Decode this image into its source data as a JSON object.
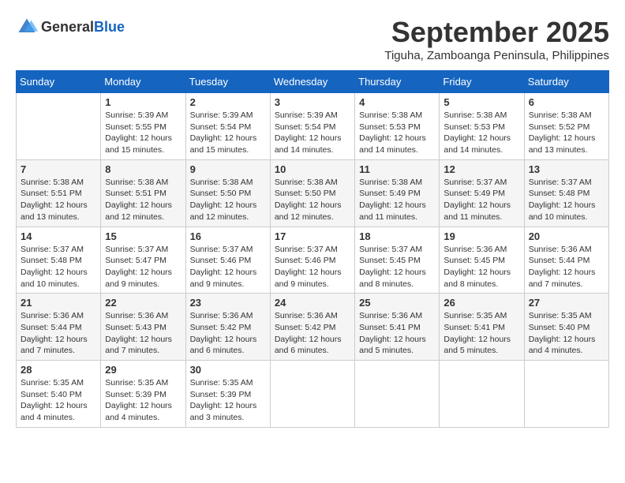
{
  "logo": {
    "general": "General",
    "blue": "Blue"
  },
  "title": "September 2025",
  "location": "Tiguha, Zamboanga Peninsula, Philippines",
  "days_of_week": [
    "Sunday",
    "Monday",
    "Tuesday",
    "Wednesday",
    "Thursday",
    "Friday",
    "Saturday"
  ],
  "weeks": [
    [
      {
        "day": "",
        "info": ""
      },
      {
        "day": "1",
        "info": "Sunrise: 5:39 AM\nSunset: 5:55 PM\nDaylight: 12 hours\nand 15 minutes."
      },
      {
        "day": "2",
        "info": "Sunrise: 5:39 AM\nSunset: 5:54 PM\nDaylight: 12 hours\nand 15 minutes."
      },
      {
        "day": "3",
        "info": "Sunrise: 5:39 AM\nSunset: 5:54 PM\nDaylight: 12 hours\nand 14 minutes."
      },
      {
        "day": "4",
        "info": "Sunrise: 5:38 AM\nSunset: 5:53 PM\nDaylight: 12 hours\nand 14 minutes."
      },
      {
        "day": "5",
        "info": "Sunrise: 5:38 AM\nSunset: 5:53 PM\nDaylight: 12 hours\nand 14 minutes."
      },
      {
        "day": "6",
        "info": "Sunrise: 5:38 AM\nSunset: 5:52 PM\nDaylight: 12 hours\nand 13 minutes."
      }
    ],
    [
      {
        "day": "7",
        "info": "Sunrise: 5:38 AM\nSunset: 5:51 PM\nDaylight: 12 hours\nand 13 minutes."
      },
      {
        "day": "8",
        "info": "Sunrise: 5:38 AM\nSunset: 5:51 PM\nDaylight: 12 hours\nand 12 minutes."
      },
      {
        "day": "9",
        "info": "Sunrise: 5:38 AM\nSunset: 5:50 PM\nDaylight: 12 hours\nand 12 minutes."
      },
      {
        "day": "10",
        "info": "Sunrise: 5:38 AM\nSunset: 5:50 PM\nDaylight: 12 hours\nand 12 minutes."
      },
      {
        "day": "11",
        "info": "Sunrise: 5:38 AM\nSunset: 5:49 PM\nDaylight: 12 hours\nand 11 minutes."
      },
      {
        "day": "12",
        "info": "Sunrise: 5:37 AM\nSunset: 5:49 PM\nDaylight: 12 hours\nand 11 minutes."
      },
      {
        "day": "13",
        "info": "Sunrise: 5:37 AM\nSunset: 5:48 PM\nDaylight: 12 hours\nand 10 minutes."
      }
    ],
    [
      {
        "day": "14",
        "info": "Sunrise: 5:37 AM\nSunset: 5:48 PM\nDaylight: 12 hours\nand 10 minutes."
      },
      {
        "day": "15",
        "info": "Sunrise: 5:37 AM\nSunset: 5:47 PM\nDaylight: 12 hours\nand 9 minutes."
      },
      {
        "day": "16",
        "info": "Sunrise: 5:37 AM\nSunset: 5:46 PM\nDaylight: 12 hours\nand 9 minutes."
      },
      {
        "day": "17",
        "info": "Sunrise: 5:37 AM\nSunset: 5:46 PM\nDaylight: 12 hours\nand 9 minutes."
      },
      {
        "day": "18",
        "info": "Sunrise: 5:37 AM\nSunset: 5:45 PM\nDaylight: 12 hours\nand 8 minutes."
      },
      {
        "day": "19",
        "info": "Sunrise: 5:36 AM\nSunset: 5:45 PM\nDaylight: 12 hours\nand 8 minutes."
      },
      {
        "day": "20",
        "info": "Sunrise: 5:36 AM\nSunset: 5:44 PM\nDaylight: 12 hours\nand 7 minutes."
      }
    ],
    [
      {
        "day": "21",
        "info": "Sunrise: 5:36 AM\nSunset: 5:44 PM\nDaylight: 12 hours\nand 7 minutes."
      },
      {
        "day": "22",
        "info": "Sunrise: 5:36 AM\nSunset: 5:43 PM\nDaylight: 12 hours\nand 7 minutes."
      },
      {
        "day": "23",
        "info": "Sunrise: 5:36 AM\nSunset: 5:42 PM\nDaylight: 12 hours\nand 6 minutes."
      },
      {
        "day": "24",
        "info": "Sunrise: 5:36 AM\nSunset: 5:42 PM\nDaylight: 12 hours\nand 6 minutes."
      },
      {
        "day": "25",
        "info": "Sunrise: 5:36 AM\nSunset: 5:41 PM\nDaylight: 12 hours\nand 5 minutes."
      },
      {
        "day": "26",
        "info": "Sunrise: 5:35 AM\nSunset: 5:41 PM\nDaylight: 12 hours\nand 5 minutes."
      },
      {
        "day": "27",
        "info": "Sunrise: 5:35 AM\nSunset: 5:40 PM\nDaylight: 12 hours\nand 4 minutes."
      }
    ],
    [
      {
        "day": "28",
        "info": "Sunrise: 5:35 AM\nSunset: 5:40 PM\nDaylight: 12 hours\nand 4 minutes."
      },
      {
        "day": "29",
        "info": "Sunrise: 5:35 AM\nSunset: 5:39 PM\nDaylight: 12 hours\nand 4 minutes."
      },
      {
        "day": "30",
        "info": "Sunrise: 5:35 AM\nSunset: 5:39 PM\nDaylight: 12 hours\nand 3 minutes."
      },
      {
        "day": "",
        "info": ""
      },
      {
        "day": "",
        "info": ""
      },
      {
        "day": "",
        "info": ""
      },
      {
        "day": "",
        "info": ""
      }
    ]
  ]
}
